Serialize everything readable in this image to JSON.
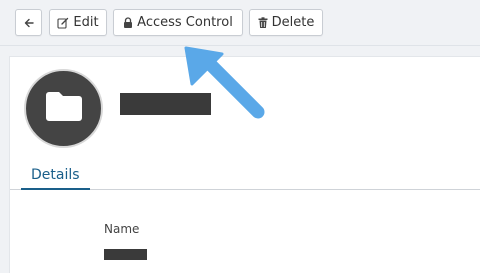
{
  "toolbar": {
    "back_icon": "arrow-left-icon",
    "edit_label": "Edit",
    "edit_icon": "edit-icon",
    "access_control_label": "Access Control",
    "access_control_icon": "lock-icon",
    "delete_label": "Delete",
    "delete_icon": "trash-icon"
  },
  "header": {
    "avatar_icon": "folder-icon"
  },
  "tabs": [
    {
      "label": "Details",
      "active": true
    }
  ],
  "details": {
    "name_label": "Name"
  },
  "colors": {
    "tab_accent": "#1a5f8a",
    "avatar_bg": "#444444",
    "pointer_arrow": "#5aa8e8"
  }
}
